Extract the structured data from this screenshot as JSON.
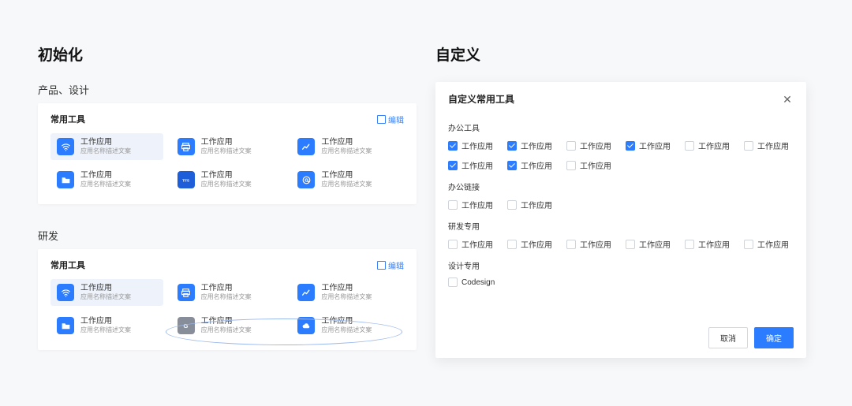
{
  "left": {
    "title": "初始化",
    "sections": [
      {
        "subtitle": "产品、设计",
        "panel_title": "常用工具",
        "edit_label": "编辑",
        "oval": false,
        "tools": [
          {
            "name": "工作应用",
            "desc": "应用名称描述文案",
            "color": "#2b7cff",
            "icon": "wifi",
            "hl": true
          },
          {
            "name": "工作应用",
            "desc": "应用名称描述文案",
            "color": "#2b7cff",
            "icon": "printer",
            "hl": false
          },
          {
            "name": "工作应用",
            "desc": "应用名称描述文案",
            "color": "#2b7cff",
            "icon": "chart",
            "hl": false
          },
          {
            "name": "工作应用",
            "desc": "应用名称描述文案",
            "color": "#2b7cff",
            "icon": "folder",
            "hl": false
          },
          {
            "name": "工作应用",
            "desc": "应用名称描述文案",
            "color": "#1e5fd9",
            "icon": "tf5",
            "hl": false
          },
          {
            "name": "工作应用",
            "desc": "应用名称描述文案",
            "color": "#2b7cff",
            "icon": "at",
            "hl": false
          }
        ]
      },
      {
        "subtitle": "研发",
        "panel_title": "常用工具",
        "edit_label": "编辑",
        "oval": true,
        "tools": [
          {
            "name": "工作应用",
            "desc": "应用名称描述文案",
            "color": "#2b7cff",
            "icon": "wifi",
            "hl": true
          },
          {
            "name": "工作应用",
            "desc": "应用名称描述文案",
            "color": "#2b7cff",
            "icon": "printer",
            "hl": false
          },
          {
            "name": "工作应用",
            "desc": "应用名称描述文案",
            "color": "#2b7cff",
            "icon": "chart",
            "hl": false
          },
          {
            "name": "工作应用",
            "desc": "应用名称描述文案",
            "color": "#2b7cff",
            "icon": "folder",
            "hl": false
          },
          {
            "name": "工作应用",
            "desc": "应用名称描述文案",
            "color": "#888e99",
            "icon": "g",
            "hl": false
          },
          {
            "name": "工作应用",
            "desc": "应用名称描述文案",
            "color": "#2b7cff",
            "icon": "cloud",
            "hl": false
          }
        ]
      }
    ]
  },
  "right": {
    "title": "自定义",
    "modal_title": "自定义常用工具",
    "cancel_label": "取消",
    "confirm_label": "确定",
    "categories": [
      {
        "name": "办公工具",
        "items": [
          {
            "label": "工作应用",
            "checked": true
          },
          {
            "label": "工作应用",
            "checked": true
          },
          {
            "label": "工作应用",
            "checked": false
          },
          {
            "label": "工作应用",
            "checked": true
          },
          {
            "label": "工作应用",
            "checked": false
          },
          {
            "label": "工作应用",
            "checked": false
          },
          {
            "label": "工作应用",
            "checked": true
          },
          {
            "label": "工作应用",
            "checked": true
          },
          {
            "label": "工作应用",
            "checked": false
          }
        ]
      },
      {
        "name": "办公链接",
        "items": [
          {
            "label": "工作应用",
            "checked": false
          },
          {
            "label": "工作应用",
            "checked": false
          }
        ]
      },
      {
        "name": "研发专用",
        "items": [
          {
            "label": "工作应用",
            "checked": false
          },
          {
            "label": "工作应用",
            "checked": false
          },
          {
            "label": "工作应用",
            "checked": false
          },
          {
            "label": "工作应用",
            "checked": false
          },
          {
            "label": "工作应用",
            "checked": false
          },
          {
            "label": "工作应用",
            "checked": false
          }
        ]
      },
      {
        "name": "设计专用",
        "items": [
          {
            "label": "Codesign",
            "checked": false
          }
        ]
      }
    ]
  }
}
